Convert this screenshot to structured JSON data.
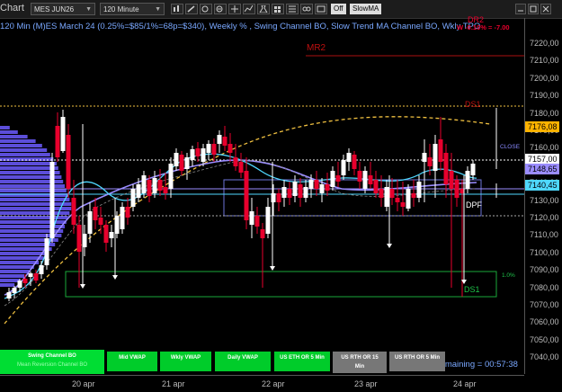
{
  "toolbar": {
    "window_label": "Chart",
    "instrument": "MES JUN26",
    "interval": "120 Minute",
    "chip_off": "Off",
    "chip_slow": "SlowMA"
  },
  "subtitle": "120 Min (M)ES March 24 (0.25%=$85/1%=68p=$340), Weekly % , Swing Channel BO, Slow Trend MA Channel BO, Wkly TPO",
  "labels": {
    "dr2": "DR2",
    "dr2_value": "W -0.10% = -7.00",
    "mr2": "MR2",
    "ds1_top": "DS1",
    "close": "CLOSE",
    "dpf": "DPF",
    "ds1": "DS1",
    "pct": "1.0%",
    "timer": "Time remaining = 00:57:38"
  },
  "y_axis": [
    "7220,00",
    "7210,00",
    "7200,00",
    "7190,00",
    "7180,00",
    "7170,00",
    "7160,00",
    "7150,00",
    "7140,00",
    "7130,00",
    "7120,00",
    "7110,00",
    "7100,00",
    "7090,00",
    "7080,00",
    "7070,00",
    "7060,00",
    "7050,00",
    "7040,00"
  ],
  "price_flags": [
    {
      "text": "7176,08",
      "color": "#ffb300"
    },
    {
      "text": "7157,00",
      "color": "#ffffff"
    },
    {
      "text": "7148,65",
      "color": "#9a8cff"
    },
    {
      "text": "7140,45",
      "color": "#4fd8ff"
    }
  ],
  "x_axis": [
    "20 apr",
    "21 apr",
    "22 apr",
    "23 apr",
    "24 apr"
  ],
  "buttons": [
    {
      "line1": "Swing Channel BO",
      "line2": "Mean Reversion Channel BO"
    },
    {
      "line1": "Mid VWAP",
      "line2": ""
    },
    {
      "line1": "Wkly VWAP",
      "line2": ""
    },
    {
      "line1": "Daily VWAP",
      "line2": ""
    },
    {
      "line1": "US ETH OR 5 Min",
      "line2": ""
    },
    {
      "line1": "US RTH OR 15",
      "line2": "Min"
    },
    {
      "line1": "US RTH OR 5 Min",
      "line2": ""
    }
  ],
  "colors": {
    "bull": "#ffffff",
    "bear": "#e8002d",
    "profile": "#6c5cff",
    "cyan": "#4fd8ff",
    "purple": "#9a8cff",
    "gold": "#f0c040",
    "green_box": "#1aa83a"
  }
}
